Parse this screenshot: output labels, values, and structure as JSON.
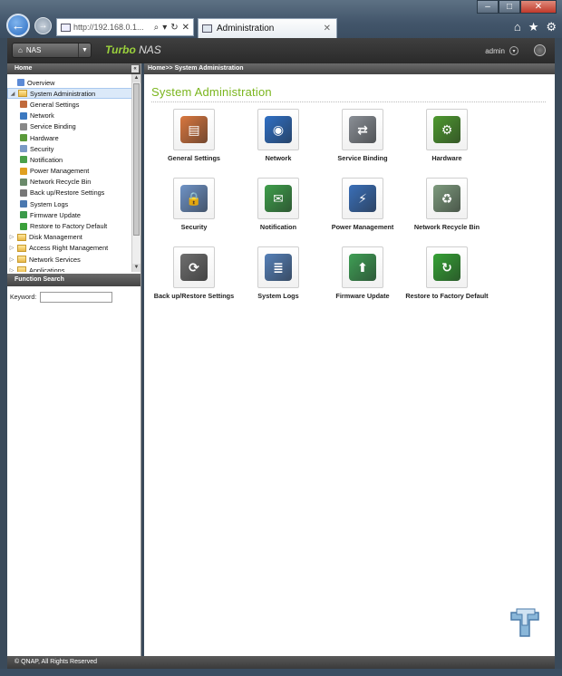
{
  "browser": {
    "address": "http://192.168.0.1...",
    "tab_title": "Administration",
    "window_buttons": [
      "minimize",
      "maximize",
      "close"
    ]
  },
  "app": {
    "nas_button": "NAS",
    "brand_prefix": "Turbo",
    "brand_suffix": "NAS",
    "user": "admin"
  },
  "left": {
    "header": "Home",
    "tree": [
      {
        "label": "Overview",
        "level": 0,
        "icon": "overview-icon",
        "color": "#5b8ad6"
      },
      {
        "label": "System Administration",
        "level": 0,
        "icon": "folder-open-icon",
        "selected": true,
        "expandable": true
      },
      {
        "label": "General Settings",
        "level": 1,
        "icon": "general-settings-icon",
        "color": "#c0693b"
      },
      {
        "label": "Network",
        "level": 1,
        "icon": "network-icon",
        "color": "#3b78c0"
      },
      {
        "label": "Service Binding",
        "level": 1,
        "icon": "service-binding-icon",
        "color": "#888888"
      },
      {
        "label": "Hardware",
        "level": 1,
        "icon": "hardware-icon",
        "color": "#5a9a3a"
      },
      {
        "label": "Security",
        "level": 1,
        "icon": "security-icon",
        "color": "#7a9ac4"
      },
      {
        "label": "Notification",
        "level": 1,
        "icon": "notification-icon",
        "color": "#4aa04a"
      },
      {
        "label": "Power Management",
        "level": 1,
        "icon": "power-management-icon",
        "color": "#e0a020"
      },
      {
        "label": "Network Recycle Bin",
        "level": 1,
        "icon": "recycle-bin-icon",
        "color": "#6a8a6a"
      },
      {
        "label": "Back up/Restore Settings",
        "level": 1,
        "icon": "backup-restore-icon",
        "color": "#777777"
      },
      {
        "label": "System Logs",
        "level": 1,
        "icon": "system-logs-icon",
        "color": "#4a78b0"
      },
      {
        "label": "Firmware Update",
        "level": 1,
        "icon": "firmware-update-icon",
        "color": "#3a9a4a"
      },
      {
        "label": "Restore to Factory Default",
        "level": 1,
        "icon": "factory-default-icon",
        "color": "#3aa03a"
      },
      {
        "label": "Disk Management",
        "level": 0,
        "icon": "folder-icon",
        "expandable": true
      },
      {
        "label": "Access Right Management",
        "level": 0,
        "icon": "folder-icon",
        "expandable": true
      },
      {
        "label": "Network Services",
        "level": 0,
        "icon": "folder-icon",
        "expandable": true
      },
      {
        "label": "Applications",
        "level": 0,
        "icon": "folder-icon",
        "expandable": true
      }
    ],
    "function_search": {
      "header": "Function Search",
      "keyword_label": "Keyword:",
      "keyword_value": ""
    }
  },
  "main": {
    "breadcrumb": "Home>> System Administration",
    "title": "System Administration",
    "items": [
      {
        "label": "General Settings",
        "icon": "general-settings-icon",
        "color": "#d9773f",
        "glyph": "▤"
      },
      {
        "label": "Network",
        "icon": "network-icon",
        "color": "#2f6fc4",
        "glyph": "◉"
      },
      {
        "label": "Service Binding",
        "icon": "service-binding-icon",
        "color": "#8a8f96",
        "glyph": "⇄"
      },
      {
        "label": "Hardware",
        "icon": "hardware-icon",
        "color": "#4e9a2f",
        "glyph": "⚙"
      },
      {
        "label": "Security",
        "icon": "security-icon",
        "color": "#6f93c6",
        "glyph": "🔒"
      },
      {
        "label": "Notification",
        "icon": "notification-icon",
        "color": "#3e9e4a",
        "glyph": "✉"
      },
      {
        "label": "Power Management",
        "icon": "power-management-icon",
        "color": "#3a6fb8",
        "glyph": "⚡"
      },
      {
        "label": "Network Recycle Bin",
        "icon": "recycle-bin-icon",
        "color": "#7d9a7d",
        "glyph": "♻"
      },
      {
        "label": "Back up/Restore Settings",
        "icon": "backup-restore-icon",
        "color": "#6e6e6e",
        "glyph": "⟳"
      },
      {
        "label": "System Logs",
        "icon": "system-logs-icon",
        "color": "#5580b8",
        "glyph": "≣"
      },
      {
        "label": "Firmware Update",
        "icon": "firmware-update-icon",
        "color": "#3f9f55",
        "glyph": "⬆"
      },
      {
        "label": "Restore to Factory Default",
        "icon": "factory-default-icon",
        "color": "#35a235",
        "glyph": "↻"
      }
    ]
  },
  "footer": {
    "copyright": "© QNAP, All Rights Reserved"
  },
  "accent_green": "#7ab51d"
}
